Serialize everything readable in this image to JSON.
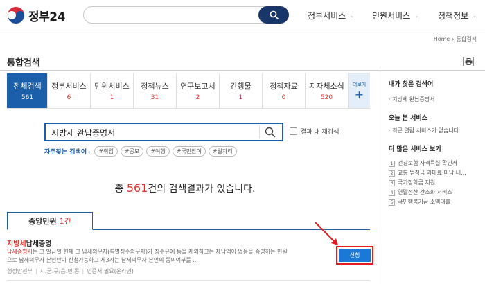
{
  "header": {
    "logo_text": "정부24",
    "search_value": "",
    "nav": [
      "정부서비스",
      "민원서비스",
      "정책정보"
    ]
  },
  "breadcrumb": [
    "Home",
    "통합검색"
  ],
  "page_title": "통합검색",
  "tabs": [
    {
      "label": "전체검색",
      "count": "561",
      "active": true
    },
    {
      "label": "정부서비스",
      "count": "6"
    },
    {
      "label": "민원서비스",
      "count": "1"
    },
    {
      "label": "정책뉴스",
      "count": "31"
    },
    {
      "label": "연구보고서",
      "count": "2"
    },
    {
      "label": "간행물",
      "count": "1"
    },
    {
      "label": "정책자료",
      "count": "0"
    },
    {
      "label": "지자체소식",
      "count": "520"
    }
  ],
  "tabs_more": {
    "label": "더보기",
    "icon": "+"
  },
  "search": {
    "value": "지방세 완납증명서",
    "refine_label": "결과 내 재검색"
  },
  "frequent": {
    "label": "자주찾는 검색어",
    "tags": [
      "#취업",
      "#공모",
      "#여행",
      "#국민참여",
      "#일자리"
    ]
  },
  "result_message": {
    "prefix": "총",
    "count": "561",
    "suffix": "건의 검색결과가 있습니다."
  },
  "section": {
    "label": "중앙민원",
    "count": "1",
    "unit": "건"
  },
  "result_item": {
    "title_hl": "지방세",
    "title_rest": "납세증명",
    "desc_hl": "납세증명서",
    "desc_line1_rest": "는 그 발급일 현재 그 납세의무자(특별징수의무자)가 징수유예 등을 제외하고는 체납액이 없음을 증명하는 민원",
    "desc_line2": "으로 납세의무자 본인만이 신청가능하고 제3자는 납세의무자 본인의 동의여부를 ...",
    "meta": [
      "행정안전부",
      "시.군.구/읍.면.동",
      "인증서 필요(온라인)"
    ],
    "apply_label": "신청"
  },
  "right_panel": {
    "section1": {
      "title": "내가 찾은 검색어",
      "items": [
        "지방세 완납증명서"
      ]
    },
    "section2": {
      "title": "오늘 본 서비스",
      "items": [
        "최근 열람 서비스가 없습니다."
      ]
    },
    "section3": {
      "title": "더 많은 서비스 보기",
      "items": [
        {
          "num": "1",
          "label": "건강보험 자격득실 확인서"
        },
        {
          "num": "2",
          "label": "교통 범칙금 과태료 미납 내..."
        },
        {
          "num": "3",
          "label": "국가장학금 지원"
        },
        {
          "num": "4",
          "label": "연말정산 간소화 서비스"
        },
        {
          "num": "5",
          "label": "국민행복기금 소액대출"
        }
      ]
    }
  },
  "colors": {
    "brand": "#1b5ea9",
    "accent_red": "#e0322d",
    "search_btn": "#19366a",
    "apply_btn": "#1b78d6"
  }
}
